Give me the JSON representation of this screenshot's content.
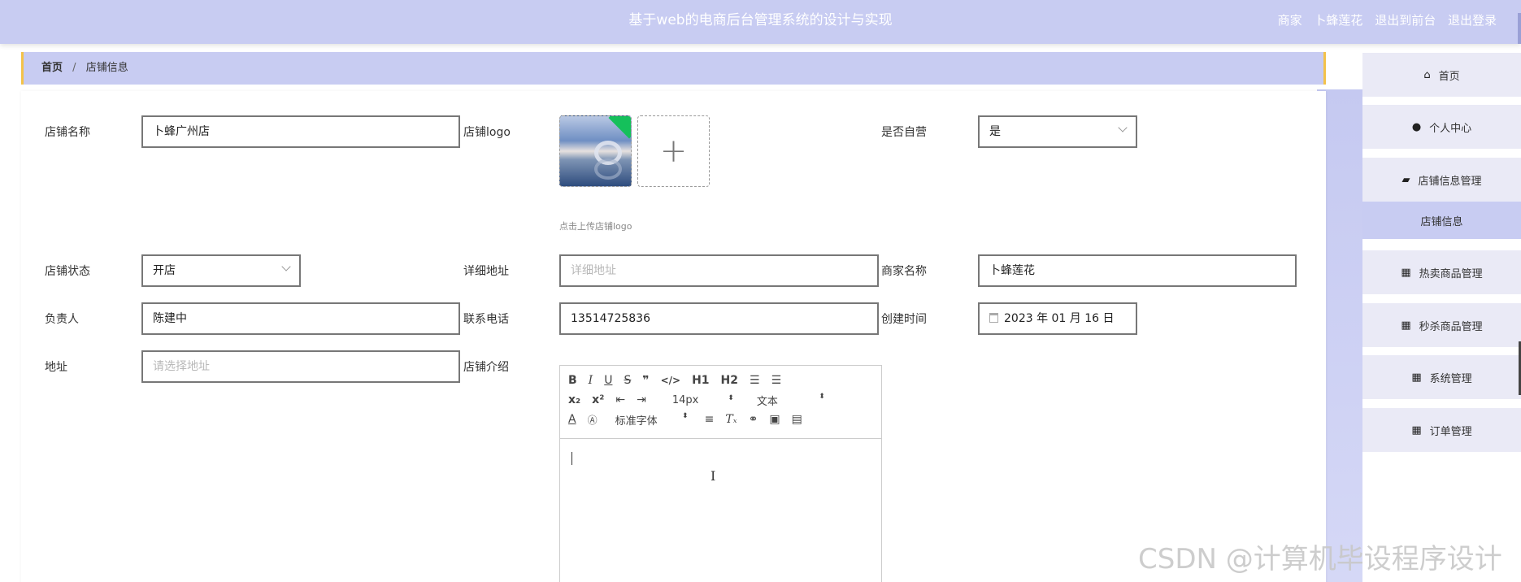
{
  "header": {
    "title": "基于web的电商后台管理系统的设计与实现",
    "role": "商家",
    "username": "卜蜂莲花",
    "to_front": "退出到前台",
    "logout": "退出登录"
  },
  "breadcrumb": {
    "home": "首页",
    "separator": "/",
    "current": "店铺信息"
  },
  "form": {
    "shop_name": {
      "label": "店铺名称",
      "value": "卜蜂广州店"
    },
    "shop_logo": {
      "label": "店铺logo",
      "hint": "点击上传店铺logo",
      "add_icon": "plus-icon"
    },
    "self_operated": {
      "label": "是否自营",
      "value": "是"
    },
    "shop_status": {
      "label": "店铺状态",
      "value": "开店"
    },
    "detail_address": {
      "label": "详细地址",
      "placeholder": "详细地址"
    },
    "merchant_name": {
      "label": "商家名称",
      "value": "卜蜂莲花"
    },
    "manager": {
      "label": "负责人",
      "value": "陈建中"
    },
    "phone": {
      "label": "联系电话",
      "value": "13514725836"
    },
    "created_time": {
      "label": "创建时间",
      "value": "2023 年 01 月 16 日"
    },
    "address": {
      "label": "地址",
      "placeholder": "请选择地址"
    },
    "intro": {
      "label": "店铺介绍"
    }
  },
  "editor": {
    "font_size": "14px",
    "text_type": "文本",
    "font_family": "标准字体",
    "tools_row1": [
      "B",
      "I",
      "U",
      "S",
      "❞",
      "</>",
      "H1",
      "H2",
      "ordered-list-icon",
      "bullet-list-icon"
    ],
    "tools_row2": [
      "subscript-icon",
      "superscript-icon",
      "outdent-icon",
      "indent-icon"
    ],
    "tools_row3": [
      "font-color-icon",
      "background-color-icon",
      "align-icon",
      "clear-format-icon",
      "link-icon",
      "image-icon",
      "video-icon"
    ]
  },
  "sidebar": {
    "items": [
      {
        "label": "首页",
        "icon": "home-icon"
      },
      {
        "label": "个人中心",
        "icon": "user-icon"
      },
      {
        "label": "店铺信息管理",
        "icon": "wallet-icon"
      },
      {
        "label": "店铺信息",
        "icon": ""
      },
      {
        "label": "热卖商品管理",
        "icon": "grid-icon"
      },
      {
        "label": "秒杀商品管理",
        "icon": "apps-icon"
      },
      {
        "label": "系统管理",
        "icon": "grid-icon"
      },
      {
        "label": "订单管理",
        "icon": "grid-icon"
      }
    ]
  },
  "watermark": "CSDN @计算机毕设程序设计",
  "colors": {
    "header_bg": "#c8ccf2",
    "breadcrumb_accent": "#f3c24a",
    "menu_bg": "#eaeaf6",
    "menu_active_bg": "#c8ccf2",
    "logo_badge": "#15c05b"
  }
}
